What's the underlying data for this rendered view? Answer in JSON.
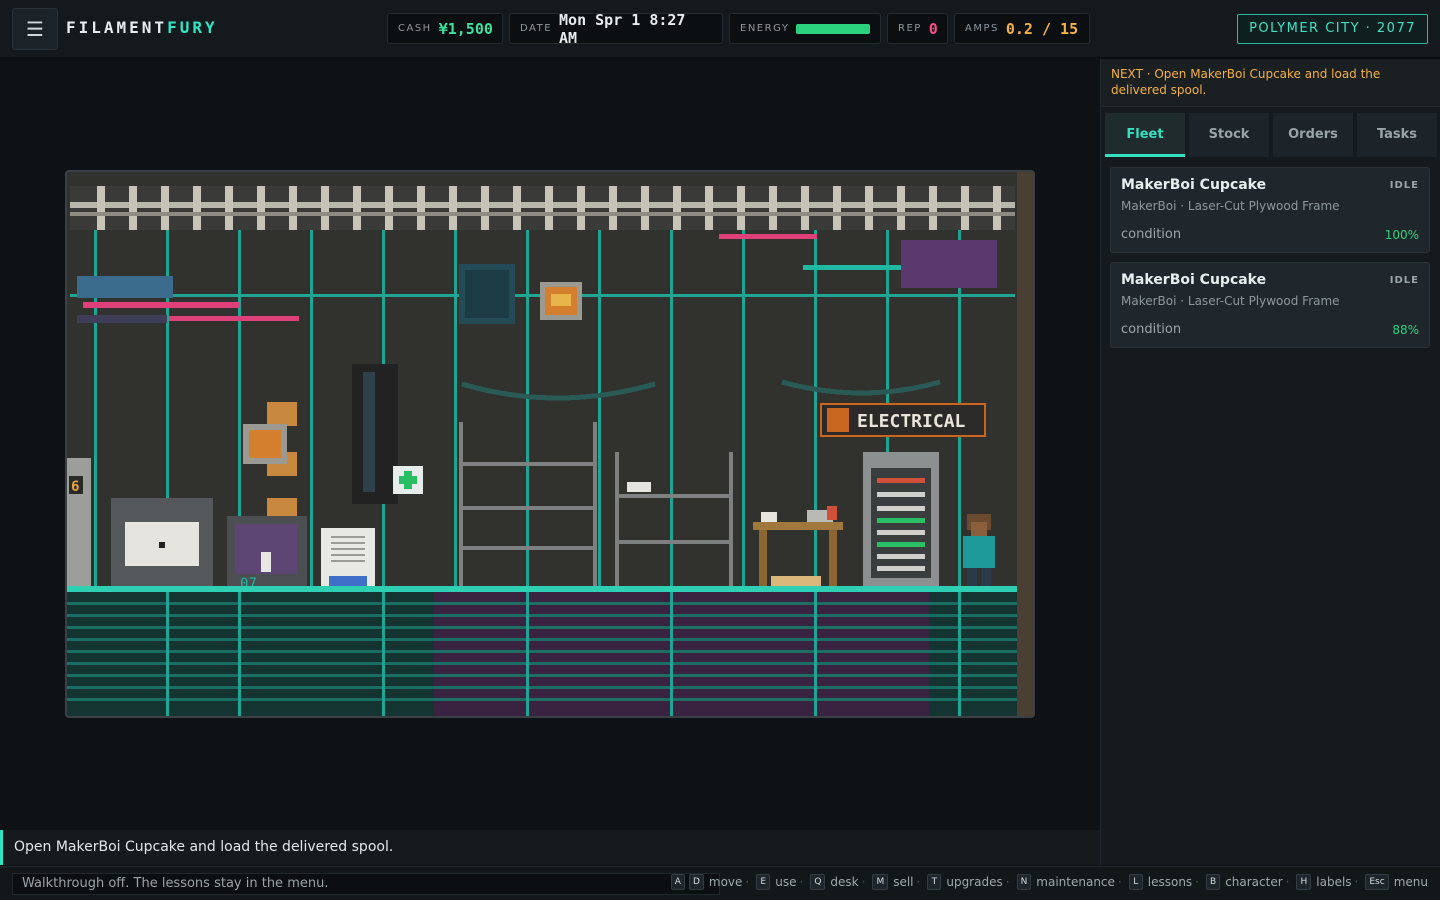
{
  "header": {
    "menu_icon": "☰",
    "logo_main": "FILAMENT",
    "logo_accent": "FURY",
    "cash_label": "CASH",
    "cash_value": "¥1,500",
    "date_label": "DATE",
    "date_value": "Mon Spr 1 8:27 AM",
    "energy_label": "ENERGY",
    "energy_level": 1.0,
    "rep_label": "REP",
    "rep_value": "0",
    "amps_label": "AMPS",
    "amps_value": "0.2 / 15",
    "city_badge": "POLYMER CITY · 2077"
  },
  "scene": {
    "sign_text": "ELECTRICAL",
    "locker_number": "6",
    "counter_digits": "07"
  },
  "sidebar": {
    "next_hint": "NEXT · Open MakerBoi Cupcake and load the delivered spool.",
    "tabs": [
      {
        "label": "Fleet",
        "active": true
      },
      {
        "label": "Stock",
        "active": false
      },
      {
        "label": "Orders",
        "active": false
      },
      {
        "label": "Tasks",
        "active": false
      }
    ],
    "fleet": [
      {
        "name": "MakerBoi Cupcake",
        "status": "IDLE",
        "subtitle": "MakerBoi · Laser-Cut Plywood Frame",
        "condition_label": "condition",
        "condition": "100%"
      },
      {
        "name": "MakerBoi Cupcake",
        "status": "IDLE",
        "subtitle": "MakerBoi · Laser-Cut Plywood Frame",
        "condition_label": "condition",
        "condition": "88%"
      }
    ]
  },
  "objective": "Open MakerBoi Cupcake and load the delivered spool.",
  "statusbar": {
    "walkthrough": "Walkthrough off. The lessons stay in the menu.",
    "hotkeys": [
      {
        "keys": [
          "A",
          "D"
        ],
        "label": "move"
      },
      {
        "keys": [
          "E"
        ],
        "label": "use"
      },
      {
        "keys": [
          "Q"
        ],
        "label": "desk"
      },
      {
        "keys": [
          "M"
        ],
        "label": "sell"
      },
      {
        "keys": [
          "T"
        ],
        "label": "upgrades"
      },
      {
        "keys": [
          "N"
        ],
        "label": "maintenance"
      },
      {
        "keys": [
          "L"
        ],
        "label": "lessons"
      },
      {
        "keys": [
          "B"
        ],
        "label": "character"
      },
      {
        "keys": [
          "H"
        ],
        "label": "labels"
      },
      {
        "keys": [
          "Esc"
        ],
        "label": "menu"
      }
    ]
  },
  "colors": {
    "accent": "#2ee6c3",
    "cash": "#3fe1a0",
    "rep": "#ff4f8b",
    "amps": "#f5b041",
    "hint": "#f5b041",
    "good": "#2bd27d"
  }
}
